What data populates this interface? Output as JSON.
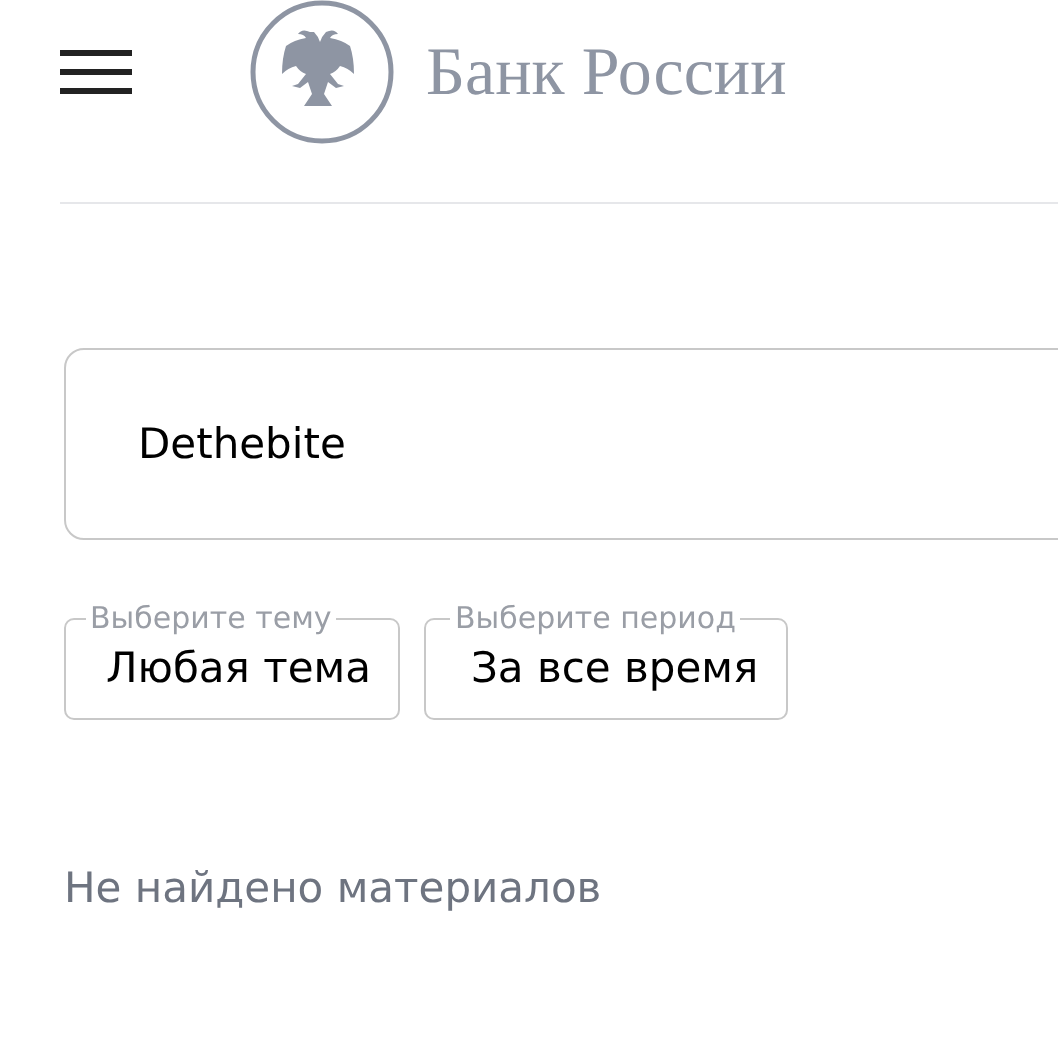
{
  "header": {
    "logo_text": "Банк России"
  },
  "search": {
    "value": "Dethebite"
  },
  "filters": [
    {
      "label": "Выберите тему",
      "value": "Любая тема"
    },
    {
      "label": "Выберите период",
      "value": "За все время"
    }
  ],
  "result_message": "Не найдено материалов"
}
